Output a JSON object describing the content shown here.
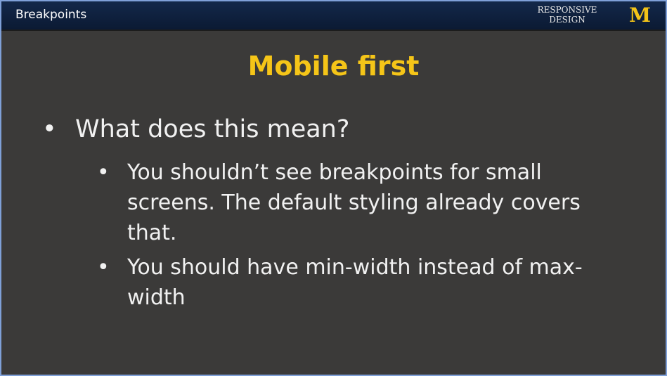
{
  "header": {
    "section": "Breakpoints",
    "course": "RESPONSIVE DESIGN",
    "logo": "M"
  },
  "title": "Mobile first",
  "bullets": [
    {
      "text": "What does this mean?",
      "children": [
        {
          "text": "You shouldn’t see breakpoints for small screens.  The default styling already covers that."
        },
        {
          "text": "You should have min-width instead of max-width"
        }
      ]
    }
  ],
  "colors": {
    "header": "#0f2240",
    "title": "#f5c518",
    "background": "#3b3a39"
  }
}
